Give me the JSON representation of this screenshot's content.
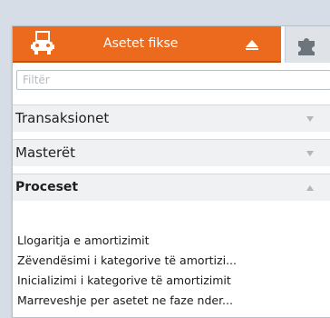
{
  "header": {
    "title": "Asetet fikse",
    "icon": "car-icon",
    "collapse_icon": "triangle-up-icon",
    "accent_color": "#ec6a1e"
  },
  "side_tab": {
    "icon": "puzzle-icon"
  },
  "filter": {
    "placeholder": "Filtër",
    "value": ""
  },
  "sections": [
    {
      "label": "Transaksionet",
      "expanded": false,
      "arrow": "chevron-down-icon"
    },
    {
      "label": "Masterët",
      "expanded": false,
      "arrow": "chevron-down-icon"
    },
    {
      "label": "Proceset",
      "expanded": true,
      "arrow": "chevron-up-icon"
    }
  ],
  "process_items": [
    "Llogaritja e amortizimit",
    "Zëvendësimi i kategorive të amortizi...",
    "Inicializimi i kategorive të amortizimit",
    "Marreveshje per asetet ne faze nder..."
  ]
}
